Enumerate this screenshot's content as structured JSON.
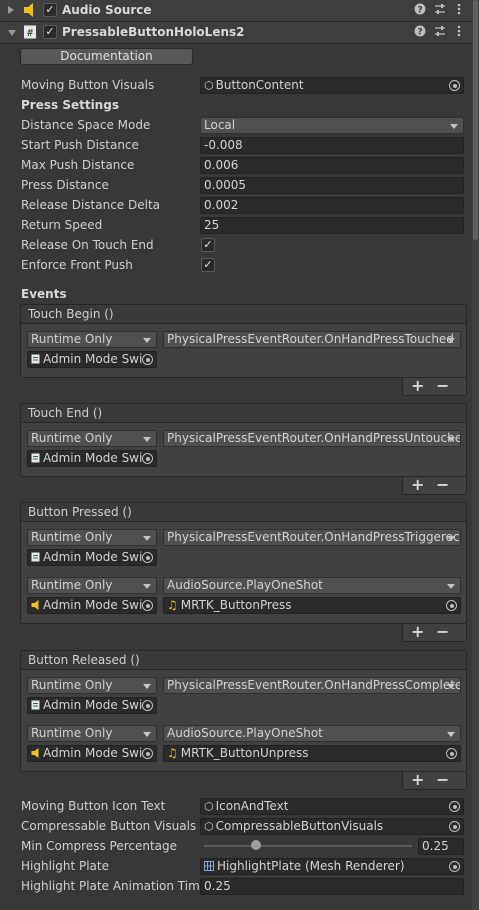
{
  "components": [
    {
      "title": "Audio Source",
      "expanded": false,
      "enabled": true,
      "icon": "speaker-icon"
    },
    {
      "title": "PressableButtonHoloLens2",
      "expanded": true,
      "enabled": true,
      "icon": "script-icon"
    }
  ],
  "documentation_label": "Documentation",
  "fields": {
    "moving_button_visuals": {
      "label": "Moving Button Visuals",
      "value": "ButtonContent"
    },
    "press_settings_heading": "Press Settings",
    "distance_space_mode": {
      "label": "Distance Space Mode",
      "value": "Local"
    },
    "start_push_distance": {
      "label": "Start Push Distance",
      "value": "-0.008"
    },
    "max_push_distance": {
      "label": "Max Push Distance",
      "value": "0.006"
    },
    "press_distance": {
      "label": "Press Distance",
      "value": "0.0005"
    },
    "release_distance_delta": {
      "label": "Release Distance Delta",
      "value": "0.002"
    },
    "return_speed": {
      "label": "Return Speed",
      "value": "25"
    },
    "release_on_touch_end": {
      "label": "Release On Touch End",
      "checked": true
    },
    "enforce_front_push": {
      "label": "Enforce Front Push",
      "checked": true
    },
    "events_heading": "Events"
  },
  "events": [
    {
      "title": "Touch Begin ()",
      "listeners": [
        {
          "mode": "Runtime Only",
          "function": "PhysicalPressEventRouter.OnHandPressTouched",
          "target": "Admin Mode Swi",
          "target_icon": "script-file-icon",
          "argument": ""
        }
      ]
    },
    {
      "title": "Touch End ()",
      "listeners": [
        {
          "mode": "Runtime Only",
          "function": "PhysicalPressEventRouter.OnHandPressUntouche",
          "target": "Admin Mode Swi",
          "target_icon": "script-file-icon",
          "argument": ""
        }
      ]
    },
    {
      "title": "Button Pressed ()",
      "listeners": [
        {
          "mode": "Runtime Only",
          "function": "PhysicalPressEventRouter.OnHandPressTriggerec",
          "target": "Admin Mode Swi",
          "target_icon": "script-file-icon",
          "argument": ""
        },
        {
          "mode": "Runtime Only",
          "function": "AudioSource.PlayOneShot",
          "target": "Admin Mode Swi",
          "target_icon": "speaker-icon",
          "argument": "MRTK_ButtonPress"
        }
      ]
    },
    {
      "title": "Button Released ()",
      "listeners": [
        {
          "mode": "Runtime Only",
          "function": "PhysicalPressEventRouter.OnHandPressComplete",
          "target": "Admin Mode Swi",
          "target_icon": "script-file-icon",
          "argument": ""
        },
        {
          "mode": "Runtime Only",
          "function": "AudioSource.PlayOneShot",
          "target": "Admin Mode Swi",
          "target_icon": "speaker-icon",
          "argument": "MRTK_ButtonUnpress"
        }
      ]
    }
  ],
  "bottom_fields": {
    "moving_button_icon_text": {
      "label": "Moving Button Icon Text",
      "value": "IconAndText"
    },
    "compressable_button_visuals": {
      "label": "Compressable Button Visuals",
      "value": "CompressableButtonVisuals"
    },
    "min_compress_percentage": {
      "label": "Min Compress Percentage",
      "value": "0.25",
      "slider_fraction": 0.25
    },
    "highlight_plate": {
      "label": "Highlight Plate",
      "value": "HighlightPlate (Mesh Renderer)"
    },
    "highlight_plate_animation_time": {
      "label": "Highlight Plate Animation Time",
      "value": "0.25"
    }
  },
  "plus_label": "+",
  "minus_label": "−",
  "colors": {
    "audio_icon": "#f0c020",
    "script_icon": "#e8e8e8",
    "panel_bg": "#383838"
  }
}
